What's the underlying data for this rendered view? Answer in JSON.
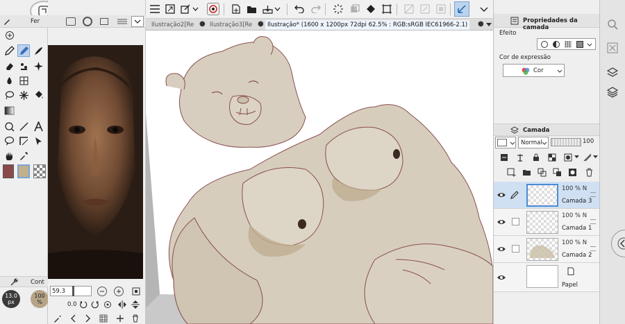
{
  "toolbar": {
    "tabs": [
      {
        "label": "Ilustração2[Re"
      },
      {
        "label": "Ilustração3[Re"
      },
      {
        "label": "Ilustração* (1600 x 1200px 72dpi 62.5% : RGB:sRGB IEC61966-2.1)"
      }
    ],
    "left_tab_label": "Fer",
    "sub_tab_label": "Cont"
  },
  "brush": {
    "size_value": "13.0",
    "size_unit": "px",
    "opacity_value": "100",
    "opacity_unit": "%"
  },
  "navigator": {
    "zoom_value": "59.3",
    "rotation_value": "0.0"
  },
  "layer_props": {
    "title": "Propriedades da camada",
    "effect_label": "Efeito",
    "expression_label": "Cor de expressão",
    "expression_value": "Cor"
  },
  "layers": {
    "title": "Camada",
    "blend_mode": "Normal",
    "opacity": "100",
    "items": [
      {
        "pct": "100 % N",
        "name": "Camada 3",
        "selected": true
      },
      {
        "pct": "100 % N",
        "name": "Camada 1",
        "selected": false
      },
      {
        "pct": "100 % N",
        "name": "Camada 2",
        "selected": false
      },
      {
        "pct": "",
        "name": "Papel",
        "selected": false
      }
    ]
  },
  "colors": {
    "main": "#8a4a4a",
    "sub": "#c2b08a",
    "accent": "#2f7fd0",
    "selected_layer": "#cfe0f3"
  }
}
